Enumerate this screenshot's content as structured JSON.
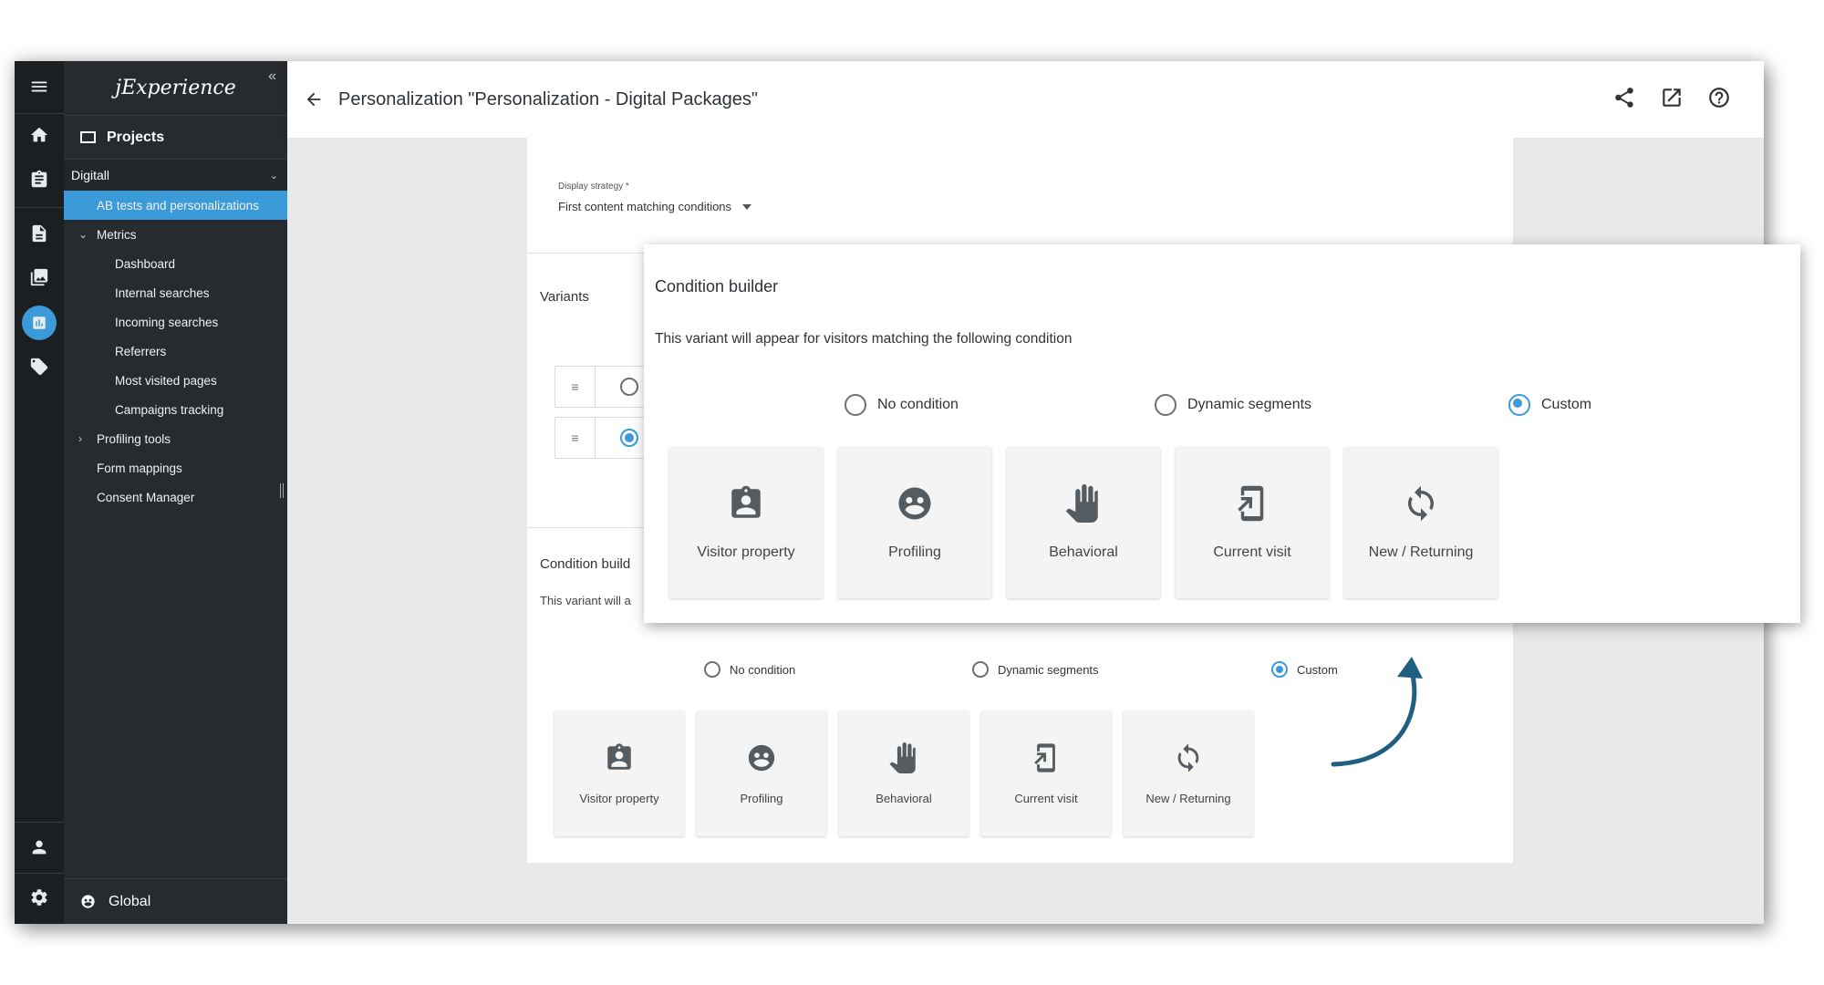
{
  "app": {
    "logo": "jExperience",
    "collapse_glyph": "«"
  },
  "rail": {
    "icons": [
      "menu-icon",
      "home-icon",
      "clipboard-icon",
      "documents-icon",
      "images-icon",
      "chart-icon",
      "tag-icon",
      "user-icon",
      "settings-icon"
    ],
    "active": "chart-icon",
    "accent": "#3b9ad8"
  },
  "sidebar": {
    "projects_label": "Projects",
    "site_name": "Digitall",
    "items": [
      {
        "label": "AB tests and personalizations",
        "selected": true
      },
      {
        "label": "Metrics",
        "expandable": true,
        "expanded": true
      },
      {
        "label": "Dashboard"
      },
      {
        "label": "Internal searches"
      },
      {
        "label": "Incoming searches"
      },
      {
        "label": "Referrers"
      },
      {
        "label": "Most visited pages"
      },
      {
        "label": "Campaigns tracking"
      },
      {
        "label": "Profiling tools",
        "expandable": true,
        "expanded": false
      },
      {
        "label": "Form mappings"
      },
      {
        "label": "Consent Manager"
      }
    ],
    "footer_label": "Global"
  },
  "header": {
    "title": "Personalization \"Personalization - Digital Packages\"",
    "back_icon": "arrow-left-icon",
    "actions": [
      "share-icon",
      "open-external-icon",
      "help-icon"
    ]
  },
  "form": {
    "display_strategy_label": "Display strategy *",
    "display_strategy_value": "First content matching conditions",
    "variants_label": "Variants",
    "condition_builder_title": "Condition build",
    "condition_builder_desc": "This variant will a",
    "options": [
      {
        "label": "No condition",
        "checked": false
      },
      {
        "label": "Dynamic segments",
        "checked": false
      },
      {
        "label": "Custom",
        "checked": true
      }
    ],
    "tiles": [
      {
        "label": "Visitor property",
        "icon": "badge-icon"
      },
      {
        "label": "Profiling",
        "icon": "face-icon"
      },
      {
        "label": "Behavioral",
        "icon": "hand-icon"
      },
      {
        "label": "Current visit",
        "icon": "device-enter-icon"
      },
      {
        "label": "New / Returning",
        "icon": "refresh-icon"
      }
    ]
  },
  "popup": {
    "title": "Condition builder",
    "description": "This variant will appear for visitors matching the following condition",
    "options": [
      {
        "label": "No condition",
        "checked": false
      },
      {
        "label": "Dynamic segments",
        "checked": false
      },
      {
        "label": "Custom",
        "checked": true
      }
    ],
    "tiles": [
      {
        "label": "Visitor property",
        "icon": "badge-icon"
      },
      {
        "label": "Profiling",
        "icon": "face-icon"
      },
      {
        "label": "Behavioral",
        "icon": "hand-icon"
      },
      {
        "label": "Current visit",
        "icon": "device-enter-icon"
      },
      {
        "label": "New / Returning",
        "icon": "refresh-icon"
      }
    ]
  },
  "annotation": {
    "arrow_color": "#1f5f80"
  }
}
